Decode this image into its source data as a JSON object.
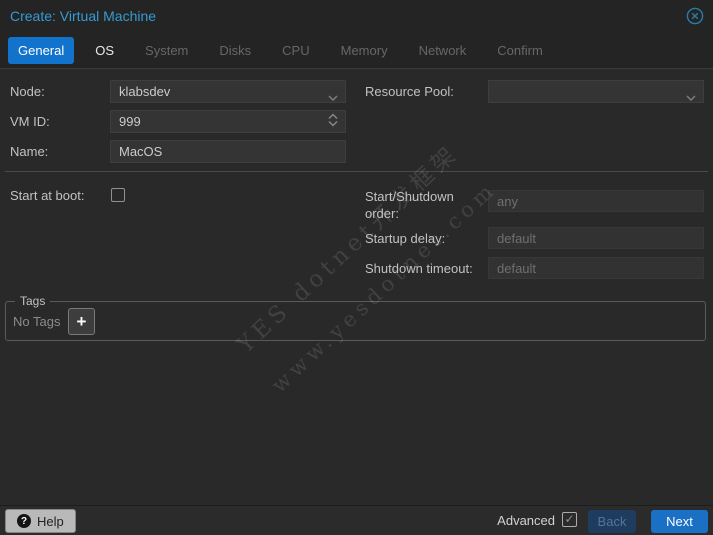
{
  "dialog": {
    "title": "Create: Virtual Machine"
  },
  "tabs": [
    {
      "label": "General",
      "state": "active"
    },
    {
      "label": "OS",
      "state": "enabled"
    },
    {
      "label": "System",
      "state": "disabled"
    },
    {
      "label": "Disks",
      "state": "disabled"
    },
    {
      "label": "CPU",
      "state": "disabled"
    },
    {
      "label": "Memory",
      "state": "disabled"
    },
    {
      "label": "Network",
      "state": "disabled"
    },
    {
      "label": "Confirm",
      "state": "disabled"
    }
  ],
  "form": {
    "node": {
      "label": "Node:",
      "value": "klabsdev"
    },
    "resource_pool": {
      "label": "Resource Pool:",
      "value": ""
    },
    "vm_id": {
      "label": "VM ID:",
      "value": "999"
    },
    "name": {
      "label": "Name:",
      "value": "MacOS"
    },
    "start_at_boot": {
      "label": "Start at boot:",
      "checked": false
    },
    "startup_order": {
      "label": "Start/Shutdown order:",
      "placeholder": "any",
      "value": ""
    },
    "startup_delay": {
      "label": "Startup delay:",
      "placeholder": "default",
      "value": ""
    },
    "shutdown_timeout": {
      "label": "Shutdown timeout:",
      "placeholder": "default",
      "value": ""
    }
  },
  "tags": {
    "legend": "Tags",
    "empty_text": "No Tags",
    "add_button_glyph": "+"
  },
  "watermark": {
    "line1": "YES dotnet开发框架",
    "line2": "www.yesdotnet.com"
  },
  "footer": {
    "help_label": "Help",
    "help_icon_glyph": "?",
    "advanced_label": "Advanced",
    "advanced_checked": true,
    "check_glyph": "✓",
    "back_label": "Back",
    "next_label": "Next"
  },
  "colors": {
    "accent": "#1273cc",
    "title_text": "#359bd3",
    "next_button": "#1a70c4",
    "back_button_bg": "#1d3c5e",
    "background": "#292929",
    "input_bg": "#343434"
  }
}
